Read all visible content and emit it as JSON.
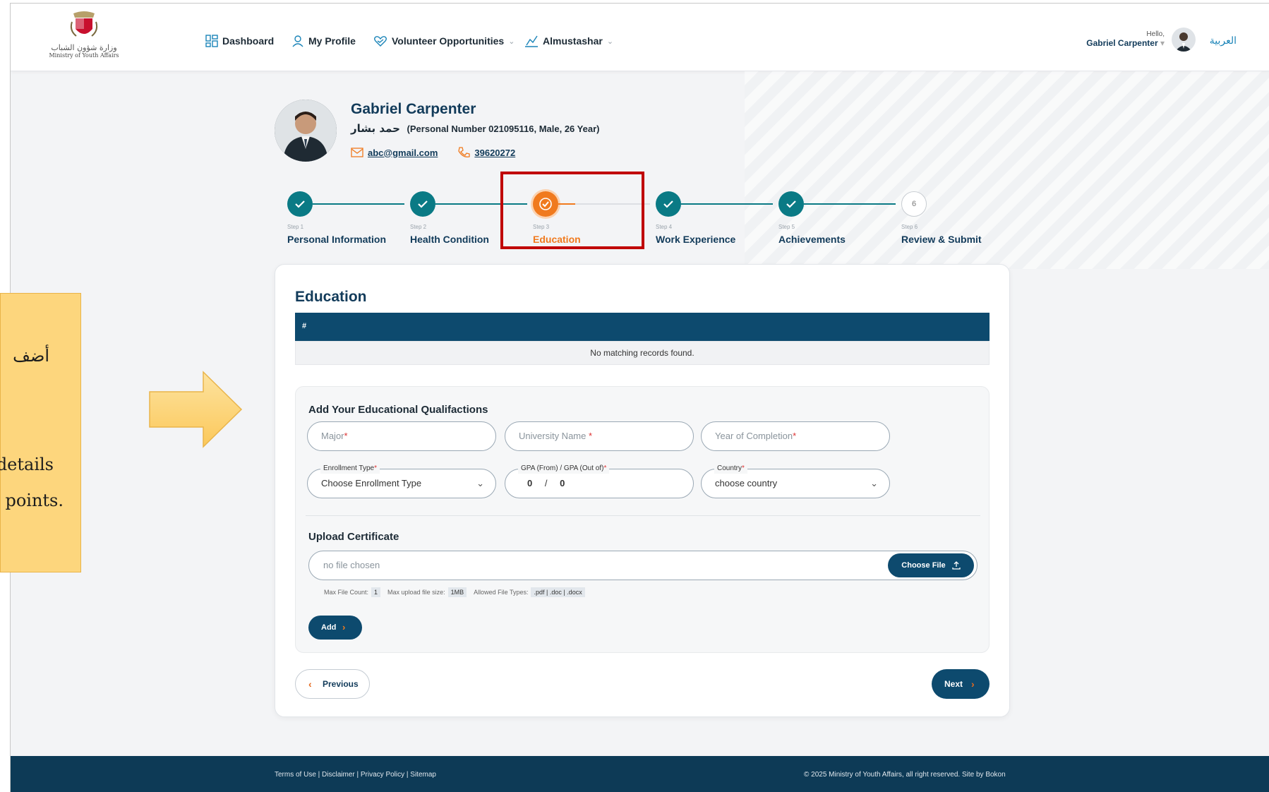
{
  "header": {
    "logo_arabic": "وزارة شؤون الشباب",
    "logo_english": "Ministry of Youth Affairs",
    "nav": [
      {
        "label": "Dashboard",
        "icon": "grid-icon"
      },
      {
        "label": "My Profile",
        "icon": "user-icon"
      },
      {
        "label": "Volunteer Opportunities",
        "icon": "heart-hand-icon"
      },
      {
        "label": "Almustashar",
        "icon": "chart-icon"
      }
    ],
    "hello": "Hello,",
    "user_name": "Gabriel Carpenter",
    "language": "العربية"
  },
  "profile": {
    "name": "Gabriel Carpenter",
    "arabic_name": "حمد بشار",
    "details": "(Personal Number 021095116, Male, 26 Year)",
    "email": "abc@gmail.com",
    "phone": "39620272"
  },
  "steps": [
    {
      "sub": "Step 1",
      "label": "Personal Information",
      "status": "done"
    },
    {
      "sub": "Step 2",
      "label": "Health Condition",
      "status": "done"
    },
    {
      "sub": "Step 3",
      "label": "Education",
      "status": "active"
    },
    {
      "sub": "Step 4",
      "label": "Work Experience",
      "status": "done"
    },
    {
      "sub": "Step 5",
      "label": "Achievements",
      "status": "done"
    },
    {
      "sub": "Step 6",
      "label": "Review & Submit",
      "status": "pending",
      "number": "6"
    }
  ],
  "education": {
    "title": "Education",
    "table_header": "#",
    "empty_text": "No matching records found.",
    "form_title": "Add Your Educational Qualifactions",
    "major_placeholder": "Major",
    "university_placeholder": "University Name ",
    "year_placeholder": "Year of Completion",
    "required_mark": "*",
    "enrollment_label": "Enrollment Type",
    "enrollment_value": "Choose Enrollment Type",
    "gpa_label": "GPA (From) / GPA (Out of)",
    "gpa_from": "0",
    "gpa_sep": "/",
    "gpa_out": "0",
    "country_label": "Country",
    "country_value": "choose country",
    "upload_title": "Upload Certificate",
    "no_file": "no file chosen",
    "choose_file": "Choose File",
    "max_count_label": "Max File Count:",
    "max_count": "1",
    "max_size_label": "Max upload file size:",
    "max_size": "1MB",
    "allowed_label": "Allowed File Types:",
    "allowed_types": ".pdf | .doc | .docx",
    "add_button": "Add",
    "previous_button": "Previous",
    "next_button": "Next"
  },
  "footer": {
    "links": "Terms of Use | Disclaimer | Privacy Policy | Sitemap",
    "copyright": "© 2025 Ministry of Youth Affairs, all right reserved. Site by Bokon"
  },
  "callout": {
    "line1": "أضف",
    "line2": "details",
    "line3": "points."
  },
  "colors": {
    "primary": "#0d4a6e",
    "teal": "#0a7a85",
    "active": "#f07a1e",
    "highlight": "#c00000",
    "callout": "#fdd67d"
  }
}
